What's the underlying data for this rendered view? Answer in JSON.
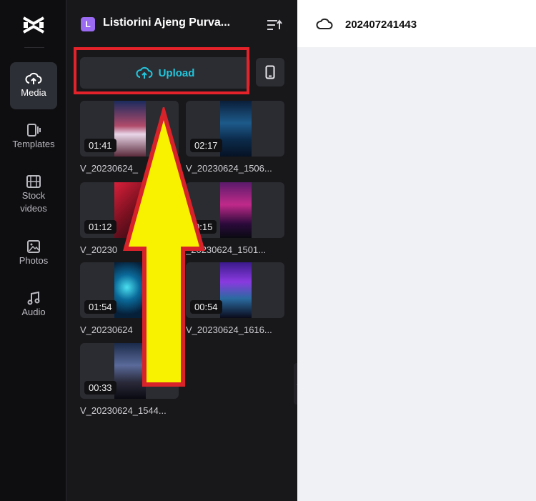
{
  "rail": {
    "items": [
      {
        "label": "Media",
        "icon": "cloud-upload-icon"
      },
      {
        "label": "Templates",
        "icon": "template-icon"
      },
      {
        "label": "Stock videos",
        "icon": "film-icon"
      },
      {
        "label": "Photos",
        "icon": "image-icon"
      },
      {
        "label": "Audio",
        "icon": "music-note-icon"
      }
    ]
  },
  "panel": {
    "workspace_initial": "L",
    "workspace_name": "Listiorini Ajeng Purva...",
    "upload_label": "Upload",
    "media": [
      {
        "duration": "01:41",
        "name": "V_20230624_"
      },
      {
        "duration": "02:17",
        "name": "V_20230624_1506..."
      },
      {
        "duration": "01:12",
        "name": "V_20230"
      },
      {
        "duration": "0:15",
        "name": "_20230624_1501..."
      },
      {
        "duration": "01:54",
        "name": "V_20230624"
      },
      {
        "duration": "00:54",
        "name": "V_20230624_1616..."
      },
      {
        "duration": "00:33",
        "name": "V_20230624_1544..."
      }
    ]
  },
  "main": {
    "project_title": "202407241443"
  },
  "colors": {
    "accent": "#22c6dc",
    "highlight": "#e4222a",
    "arrow_fill": "#f8f200",
    "badge": "#9b6bf4"
  }
}
